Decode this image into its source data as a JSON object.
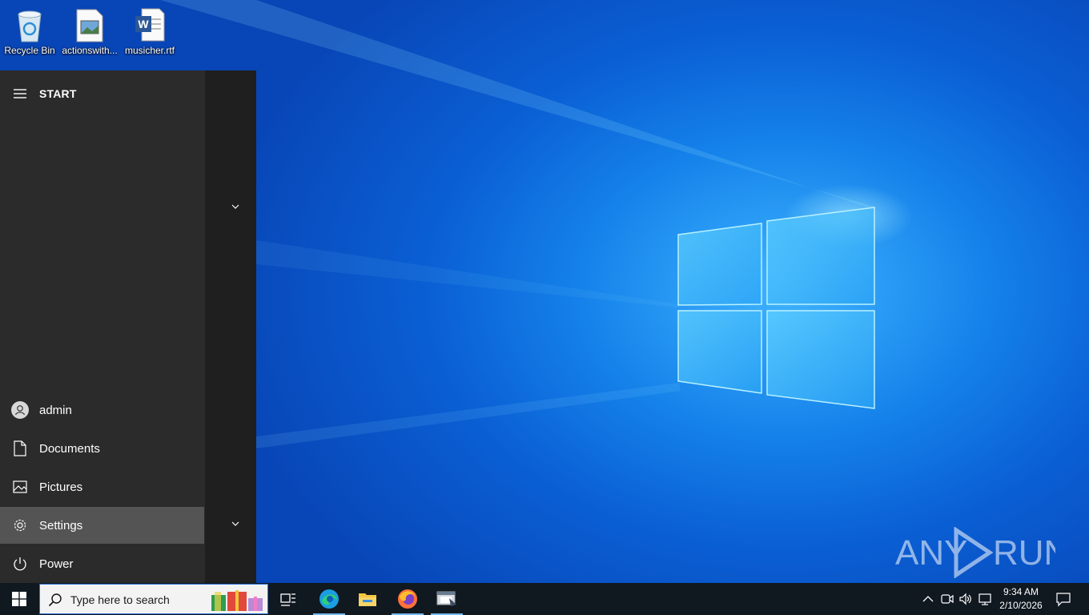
{
  "desktop": {
    "icons": [
      {
        "label": "Recycle Bin"
      },
      {
        "label": "actionswith..."
      },
      {
        "label": "musicher.rtf"
      }
    ]
  },
  "start_menu": {
    "header": "START",
    "items": [
      {
        "label": "admin",
        "icon": "user-icon"
      },
      {
        "label": "Documents",
        "icon": "document-icon"
      },
      {
        "label": "Pictures",
        "icon": "pictures-icon"
      },
      {
        "label": "Settings",
        "icon": "gear-icon",
        "active": true
      },
      {
        "label": "Power",
        "icon": "power-icon"
      }
    ]
  },
  "taskbar": {
    "search_placeholder": "Type here to search",
    "apps": [
      "task-view",
      "edge",
      "file-explorer",
      "firefox",
      "app-window"
    ],
    "clock_time": "9:34 AM",
    "clock_date": "2/10/2026"
  },
  "watermark": {
    "text": "ANY RUN"
  },
  "colors": {
    "start_bg": "#2b2b2b",
    "start_list_bg": "#1f1f1f",
    "active_item": "#545454",
    "taskbar": "#101820",
    "accent": "#76b9ed"
  }
}
